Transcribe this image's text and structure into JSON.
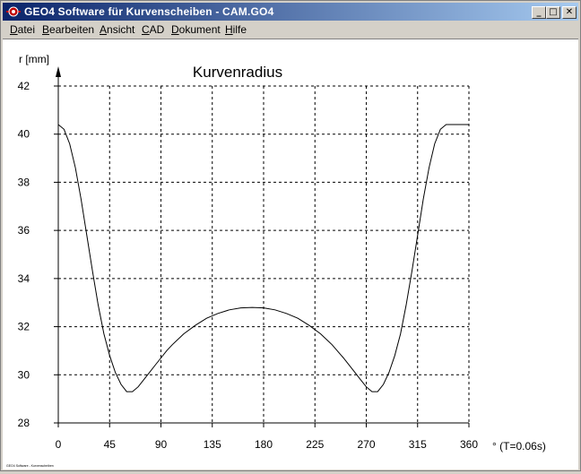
{
  "window": {
    "title": "GEO4  Software für Kurvenscheiben  -  CAM.GO4",
    "controls": {
      "minimize": "_",
      "maximize": "□",
      "close": "✕"
    }
  },
  "menu": [
    {
      "label": "Datei",
      "hotkey": "D",
      "rest": "atei"
    },
    {
      "label": "Bearbeiten",
      "hotkey": "B",
      "rest": "earbeiten"
    },
    {
      "label": "Ansicht",
      "hotkey": "A",
      "rest": "nsicht"
    },
    {
      "label": "CAD",
      "hotkey": "C",
      "rest": "AD"
    },
    {
      "label": "Dokument",
      "hotkey": "D",
      "rest": "okument"
    },
    {
      "label": "Hilfe",
      "hotkey": "H",
      "rest": "ilfe"
    }
  ],
  "chart_data": {
    "type": "line",
    "title": "Kurvenradius",
    "ylabel": "r [mm]",
    "xlabel": "° (T=0.06s)",
    "xlim": [
      0,
      360
    ],
    "ylim": [
      28,
      42
    ],
    "xticks": [
      0,
      45,
      90,
      135,
      180,
      225,
      270,
      315,
      360
    ],
    "yticks": [
      28,
      30,
      32,
      34,
      36,
      38,
      40,
      42
    ],
    "grid": true,
    "series": [
      {
        "color": "#000000",
        "x": [
          0,
          5,
          10,
          15,
          20,
          25,
          30,
          35,
          40,
          45,
          50,
          55,
          60,
          65,
          70,
          75,
          80,
          85,
          90,
          95,
          100,
          110,
          120,
          130,
          140,
          150,
          160,
          170,
          180,
          190,
          200,
          210,
          220,
          230,
          240,
          250,
          260,
          265,
          270,
          275,
          280,
          285,
          290,
          295,
          300,
          305,
          310,
          315,
          320,
          325,
          330,
          335,
          340,
          345,
          350,
          355,
          360
        ],
        "y": [
          40.4,
          40.2,
          39.6,
          38.6,
          37.3,
          35.8,
          34.3,
          32.9,
          31.7,
          30.8,
          30.1,
          29.6,
          29.3,
          29.3,
          29.5,
          29.8,
          30.1,
          30.4,
          30.7,
          31.0,
          31.25,
          31.7,
          32.05,
          32.35,
          32.55,
          32.7,
          32.78,
          32.8,
          32.78,
          32.7,
          32.55,
          32.35,
          32.05,
          31.7,
          31.25,
          30.7,
          30.1,
          29.8,
          29.5,
          29.3,
          29.3,
          29.6,
          30.1,
          30.8,
          31.7,
          32.9,
          34.3,
          35.8,
          37.3,
          38.6,
          39.6,
          40.2,
          40.4,
          40.4,
          40.4,
          40.4,
          40.4
        ]
      }
    ]
  },
  "status": {
    "footer_text": "GEO4 Software - Kurvenscheiben"
  }
}
